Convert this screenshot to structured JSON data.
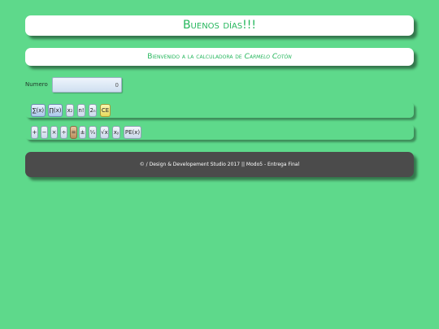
{
  "header": {
    "greeting": "Buenos días!!!",
    "welcome_prefix": "Bienvenido a la calculadora de ",
    "welcome_author": "Carmelo Cotón"
  },
  "input": {
    "label": "Numero",
    "value": "0"
  },
  "row1": {
    "sum": "∑(x)",
    "product": "∏(x)",
    "square_base": "x",
    "square_exp": "2",
    "factorial": "n!",
    "pow2_base": "2",
    "pow2_exp": "n",
    "clear": "CE"
  },
  "row2": {
    "add": "+",
    "subtract": "−",
    "multiply": "×",
    "divide": "÷",
    "equals": "=",
    "negate": "±",
    "reciprocal": "¹⁄ₓ",
    "sqrt": "√x",
    "power_base": "x",
    "power_exp": "y",
    "pe": "PE(x)"
  },
  "footer": {
    "text": "© / Design & Developement Studio 2017 || Modo5 - Entrega Final"
  },
  "colors": {
    "background": "#5ed98b",
    "accent_text": "#26b75d",
    "footer_bg": "#4b4b4b",
    "clear_button": "#e6d95c",
    "equals_button": "#b98d5c"
  }
}
